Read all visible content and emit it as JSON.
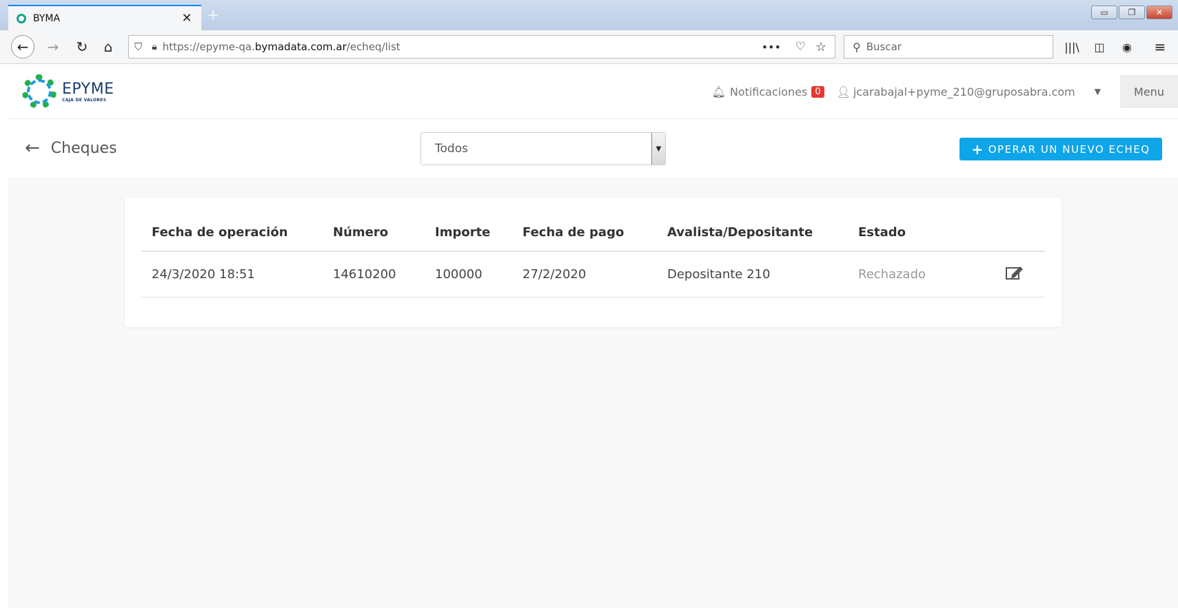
{
  "browser": {
    "tab_title": "BYMA",
    "url_prefix": "https://epyme-qa.",
    "url_domain": "bymadata.com.ar",
    "url_path": "/echeq/list",
    "search_placeholder": "Buscar",
    "page_actions": "•••"
  },
  "header": {
    "logo_brand": "EPYME",
    "logo_sub": "CAJA DE VALORES",
    "notifications_label": "Notificaciones",
    "notifications_count": "0",
    "user_email": "jcarabajal+pyme_210@gruposabra.com",
    "menu_label": "Menu"
  },
  "toolbar": {
    "page_title": "Cheques",
    "filter_selected": "Todos",
    "new_button_label": "OPERAR UN NUEVO ECHEQ"
  },
  "table": {
    "columns": [
      "Fecha de operación",
      "Número",
      "Importe",
      "Fecha de pago",
      "Avalista/Depositante",
      "Estado"
    ],
    "rows": [
      {
        "fecha_operacion": "24/3/2020 18:51",
        "numero": "14610200",
        "importe": "100000",
        "fecha_pago": "27/2/2020",
        "avalista": "Depositante 210",
        "estado": "Rechazado"
      }
    ]
  },
  "icons": {
    "back": "arrow-left-icon",
    "notifications": "bell-icon",
    "user": "user-icon",
    "edit": "edit-icon"
  },
  "colors": {
    "primary": "#0ea5e9",
    "badge": "#e53935",
    "brand": "#1b3c6d"
  }
}
